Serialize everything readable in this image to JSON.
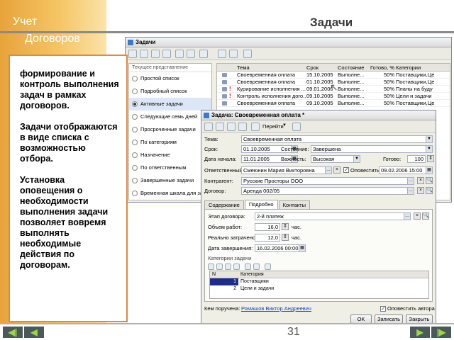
{
  "slide": {
    "title_left_1": "Учет",
    "title_left_2": "Договоров",
    "title_right": "Задачи",
    "page_number": "31",
    "note_paragraphs": [
      "формирование и контроль выполнения задач в рамках договоров.",
      "Задачи отображаются в виде списка с возможностью отбора.",
      "Установка оповещения о необходимости выполнения задачи позволяет вовремя выполнять необходимые действия по договорам."
    ],
    "colors": {
      "accent_orange": "#e08a3a",
      "nav_green": "#9fd640"
    }
  },
  "list_window": {
    "title": "Задачи",
    "filter_group": "Текущее представление",
    "views": [
      "Простой список",
      "Подробный список",
      "Активные задачи",
      "Следующие семь дней",
      "Просроченные задачи",
      "По категориям",
      "Назначение",
      "По ответственным",
      "Завершенные задачи",
      "Временная шкала для за"
    ],
    "selected_view_index": 2,
    "columns": [
      "Тема",
      "Срок",
      "Состояние",
      "Готово, %",
      "Категории"
    ],
    "rows": [
      {
        "topic": "Своевременная оплата",
        "due": "15.10.2005",
        "state": "Выполне...",
        "done": "50%",
        "category": "Поставщики,Це",
        "flag": ""
      },
      {
        "topic": "Своевременная оплата",
        "due": "01.10.2005",
        "state": "Выполне...",
        "done": "50%",
        "category": "Поставщики,Це",
        "flag": ""
      },
      {
        "topic": "Курирование исполнения ...",
        "due": "09.01.2006",
        "state": "Выполне...",
        "done": "50%",
        "category": "Планы на буду",
        "flag": "!"
      },
      {
        "topic": "Контроль исполнения дого...",
        "due": "09.10.2005",
        "state": "Выполне...",
        "done": "50%",
        "category": "Цели и задачи",
        "flag": "!"
      },
      {
        "topic": "Своевременная оплата",
        "due": "09.10.2005",
        "state": "Выполне...",
        "done": "50%",
        "category": "Поставщики,Це",
        "flag": ""
      }
    ]
  },
  "detail_window": {
    "title": "Задача: Своевременная оплата *",
    "goto_label": "Перейти",
    "labels": {
      "topic": "Тема:",
      "due": "Срок:",
      "state": "Состояние:",
      "start": "Дата начала:",
      "importance": "Важность:",
      "ready": "Готово:",
      "responsible": "Ответственный:",
      "notify": "Оповестить:",
      "counterparty": "Контрагент:",
      "contract": "Договор:",
      "stage": "Этап договора:",
      "work_volume": "Объем работ:",
      "actual_spent": "Реально затрачено:",
      "completion_date": "Дата завершения:",
      "hours": "час.",
      "task_categories": "Категории задачи",
      "assigned_by": "Кем поручена:",
      "notify_author": "Оповестить автора"
    },
    "values": {
      "topic": "Своевременная оплата",
      "due": "01.10.2005",
      "state": "Завершена",
      "start": "11.01.2005",
      "importance": "Высокая",
      "ready": "100",
      "responsible": "Смеюнин Мария Викторовна",
      "notify_datetime": "09.02.2006 15:00",
      "counterparty": "Русские Просторы ООО",
      "contract": "Аренда 002/05",
      "stage": "2-й платеж",
      "work_volume": "16,0",
      "actual_spent": "12,0",
      "completion_date": "16.02.2006 00:00",
      "assigned_by": "Ромашов Виктор Андреевич"
    },
    "tabs": [
      "Содержание",
      "Подробно",
      "Контакты"
    ],
    "active_tab_index": 1,
    "category_columns": [
      "N",
      "Категория"
    ],
    "categories": [
      {
        "n": "1",
        "name": "Поставщики"
      },
      {
        "n": "2",
        "name": "Цели и задачи"
      }
    ],
    "buttons": {
      "ok": "OK",
      "write": "Записать",
      "close": "Закрыть"
    }
  }
}
